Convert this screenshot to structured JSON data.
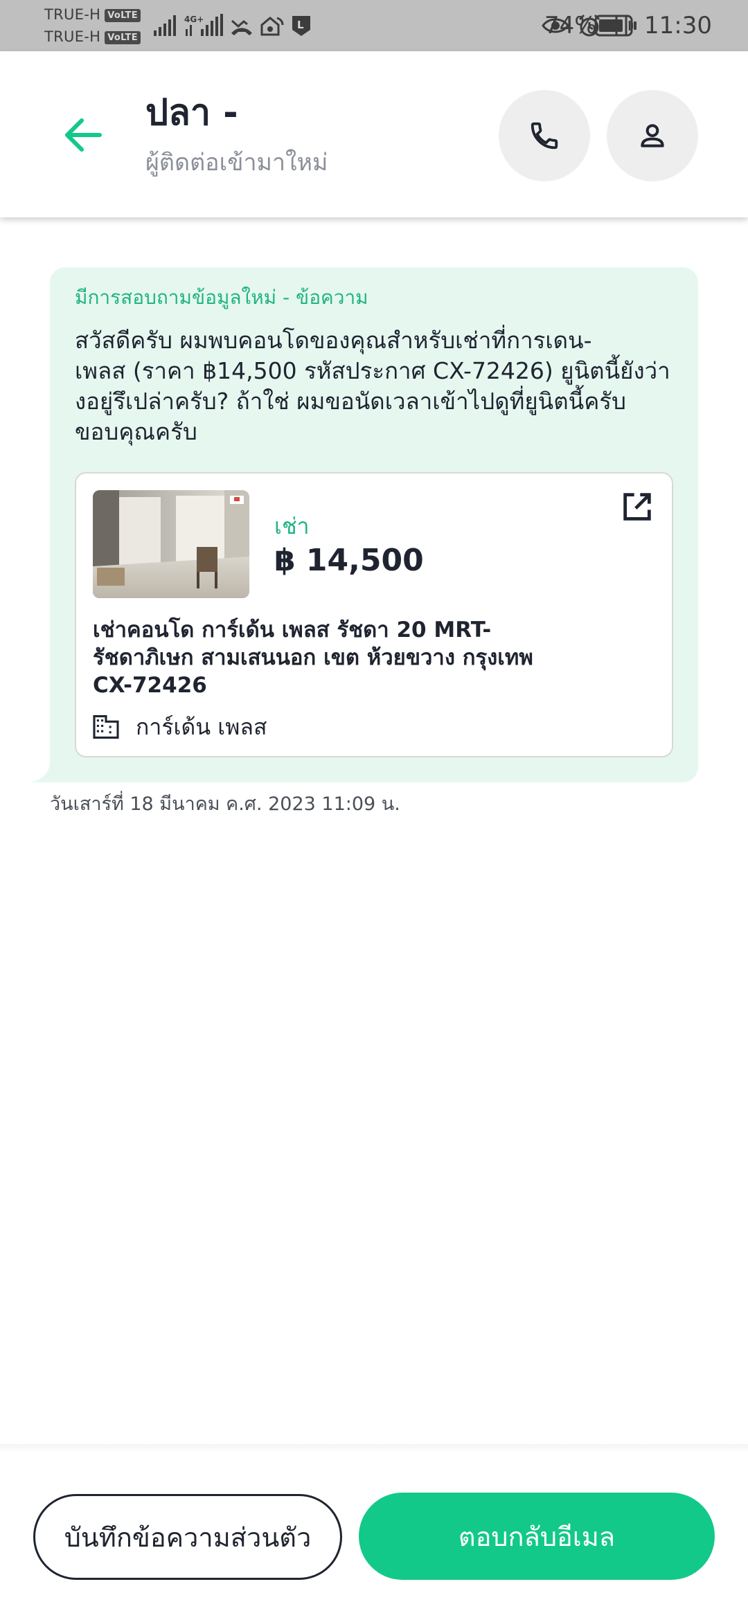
{
  "status_bar": {
    "carrier_1": "TRUE-H",
    "carrier_2": "TRUE-H",
    "volte_badge": "VoLTE",
    "network_label": "4G+",
    "battery_percent": "74%",
    "time": "11:30"
  },
  "header": {
    "contact_name": "ปลา -",
    "contact_status": "ผู้ติดต่อเข้ามาใหม่"
  },
  "message": {
    "header": "มีการสอบถามข้อมูลใหม่ - ข้อความ",
    "body": "สวัสดีครับ ผมพบคอนโดของคุณสำหรับเช่าที่การเดน-\nเพลส (ราคา ฿14,500 รหัสประกาศ CX-72426) ยูนิตนี้ยังว่า\nงอยู่รึเปล่าครับ? ถ้าใช่ ผมขอนัดเวลาเข้าไปดูที่ยูนิตนี้ครับ\nขอบคุณครับ",
    "timestamp": "วันเสาร์ที่ 18 มีนาคม ค.ศ. 2023 11:09 น."
  },
  "listing": {
    "type": "เช่า",
    "price": "฿ 14,500",
    "title": "เช่าคอนโด  การ์เด้น เพลส รัชดา 20 MRT-\nรัชดาภิเษก สามเสนนอก เขต ห้วยขวาง กรุงเทพ\nCX-72426",
    "project": "การ์เด้น เพลส"
  },
  "actions": {
    "private_note": "บันทึกข้อความส่วนตัว",
    "reply_email": "ตอบกลับอีเมล"
  },
  "colors": {
    "accent": "#12c98a",
    "accent_text": "#1fb57e",
    "bubble_bg": "#e6f7f0",
    "status_bar_bg": "#bfbfbf"
  }
}
